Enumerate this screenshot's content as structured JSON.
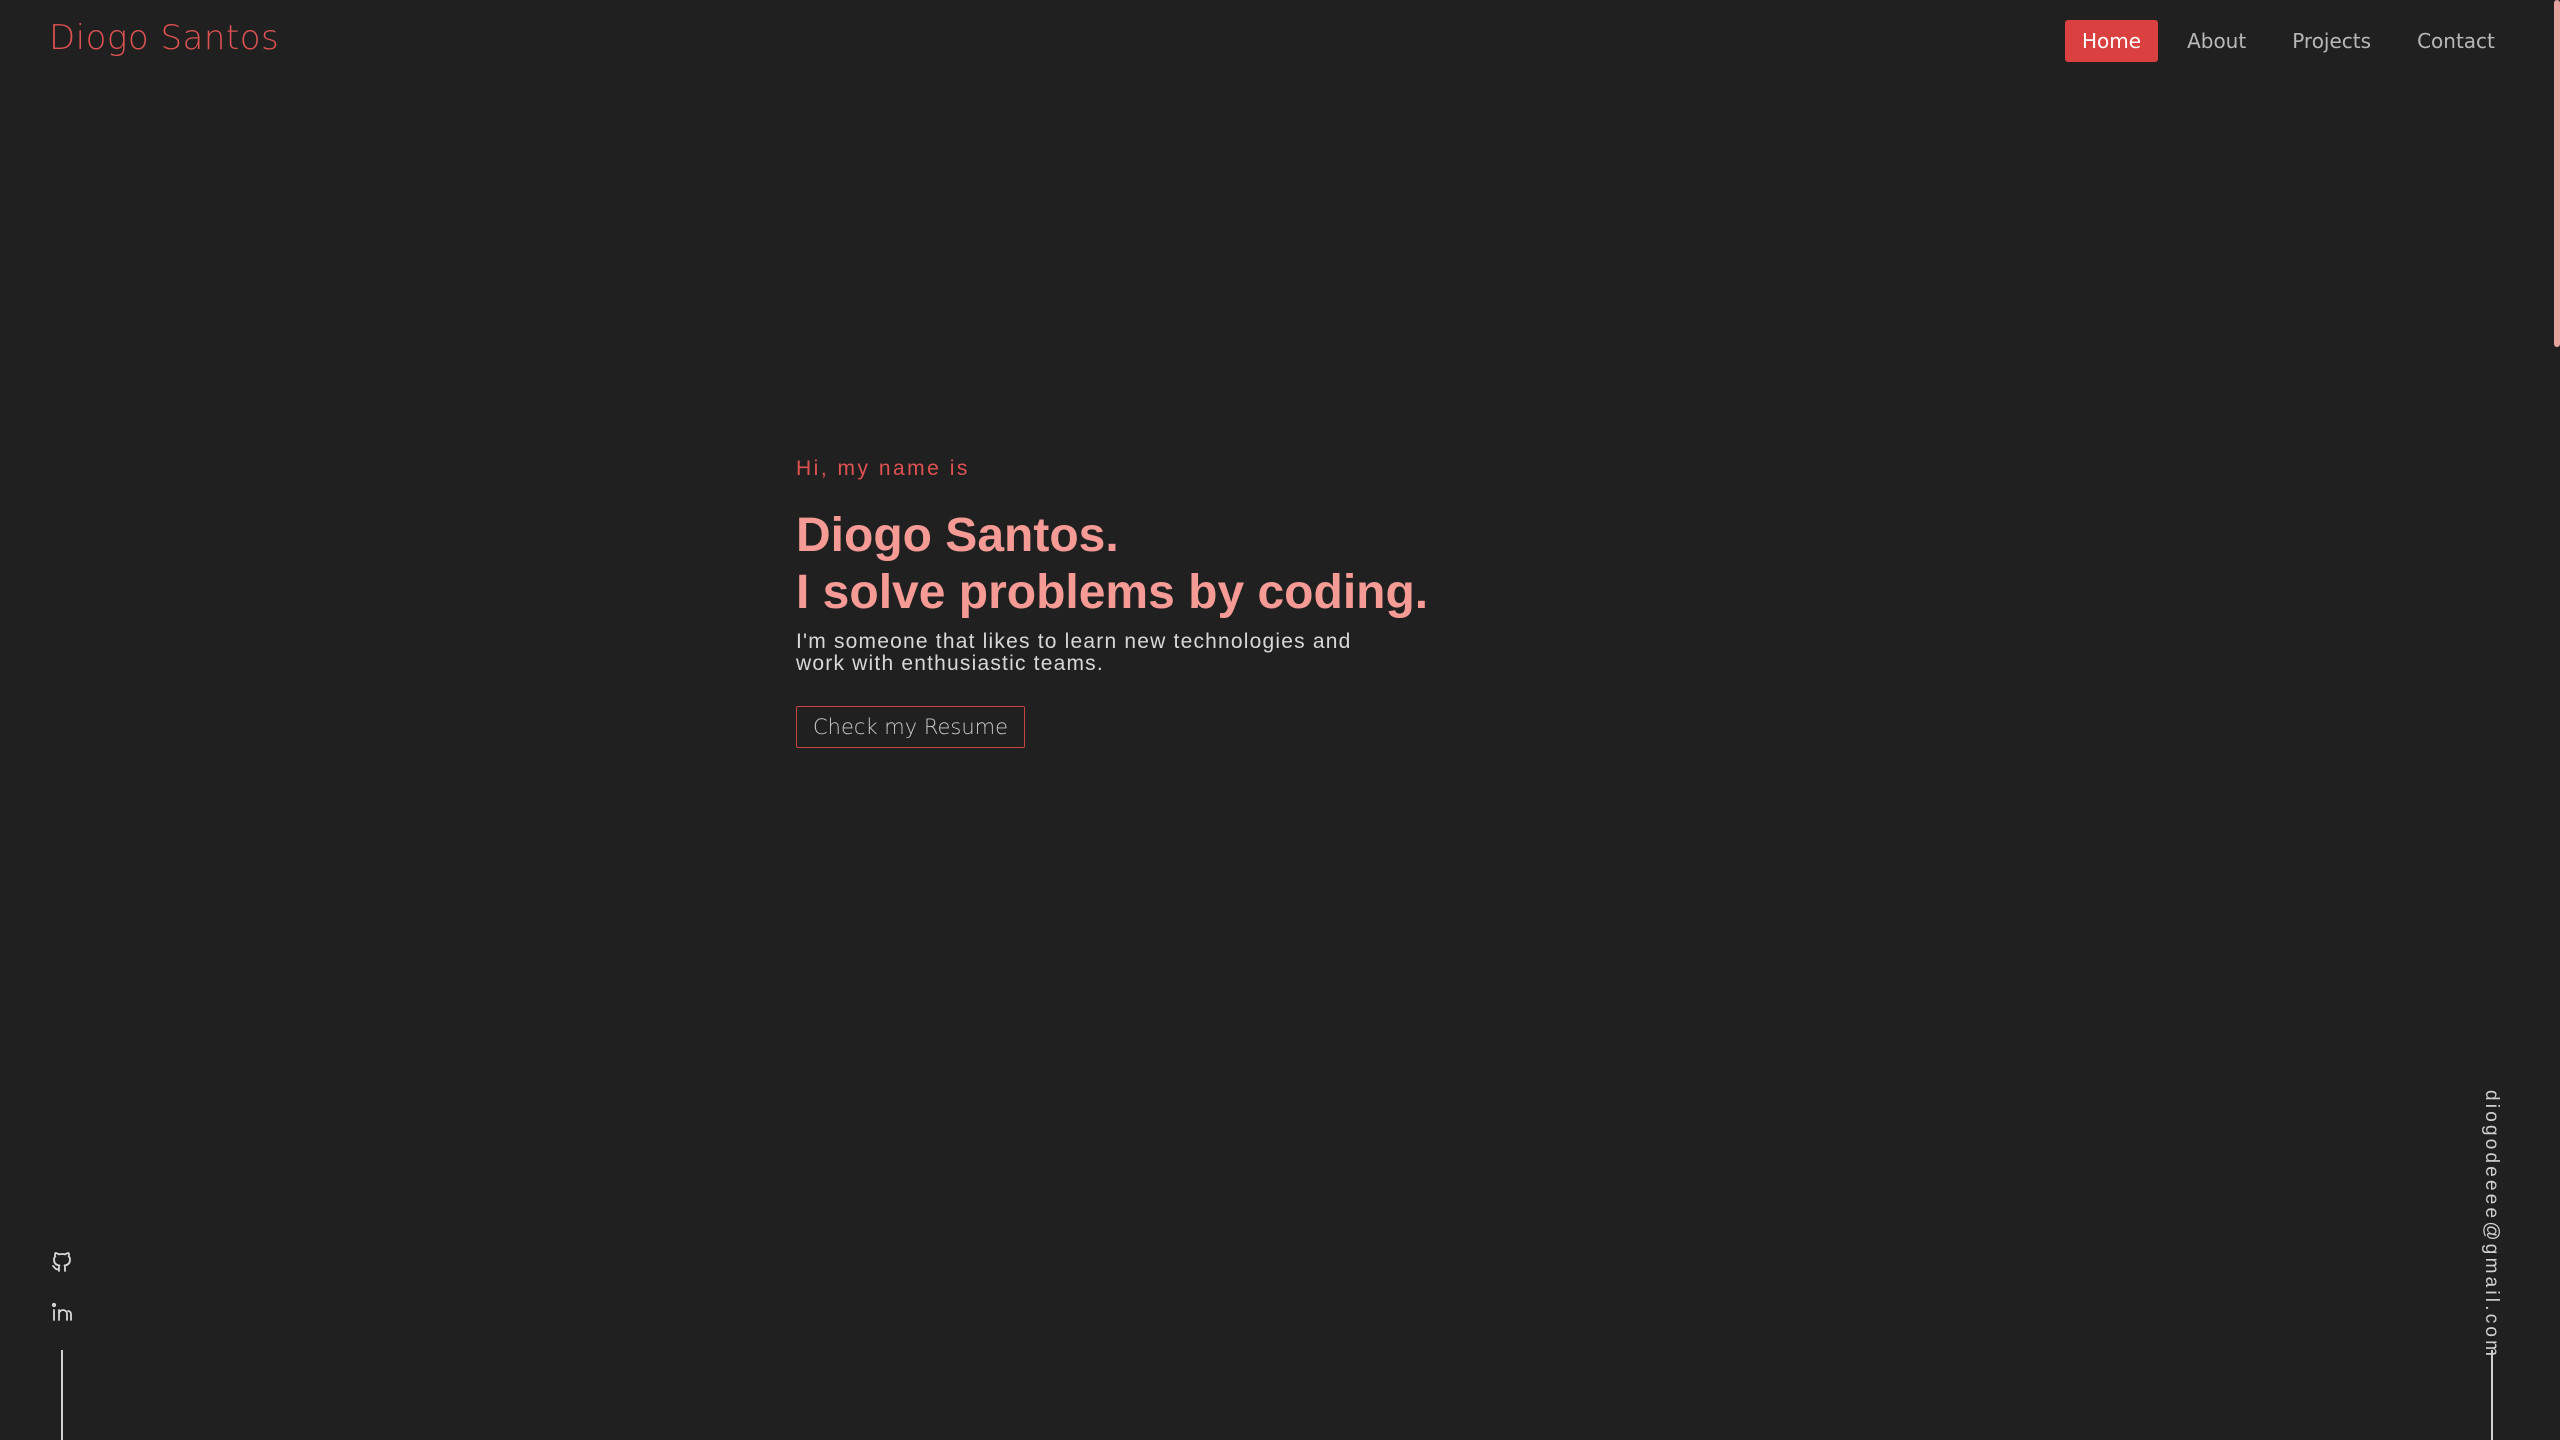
{
  "header": {
    "brand": "Diogo Santos",
    "nav": [
      {
        "label": "Home",
        "active": true
      },
      {
        "label": "About",
        "active": false
      },
      {
        "label": "Projects",
        "active": false
      },
      {
        "label": "Contact",
        "active": false
      }
    ]
  },
  "hero": {
    "intro": "Hi, my name is",
    "name_line": "Diogo Santos.",
    "tagline": "I solve problems by coding.",
    "blurb": "I'm someone that likes to learn new technologies and work with enthusiastic teams.",
    "button": "Check my Resume"
  },
  "socials": [
    {
      "icon": "github-icon"
    },
    {
      "icon": "linkedin-icon"
    }
  ],
  "email": "diogodeeee@gmail.com",
  "colors": {
    "background": "#202020",
    "accent": "#d9403f",
    "headline": "#f59a94",
    "text": "#d8d8d8"
  }
}
